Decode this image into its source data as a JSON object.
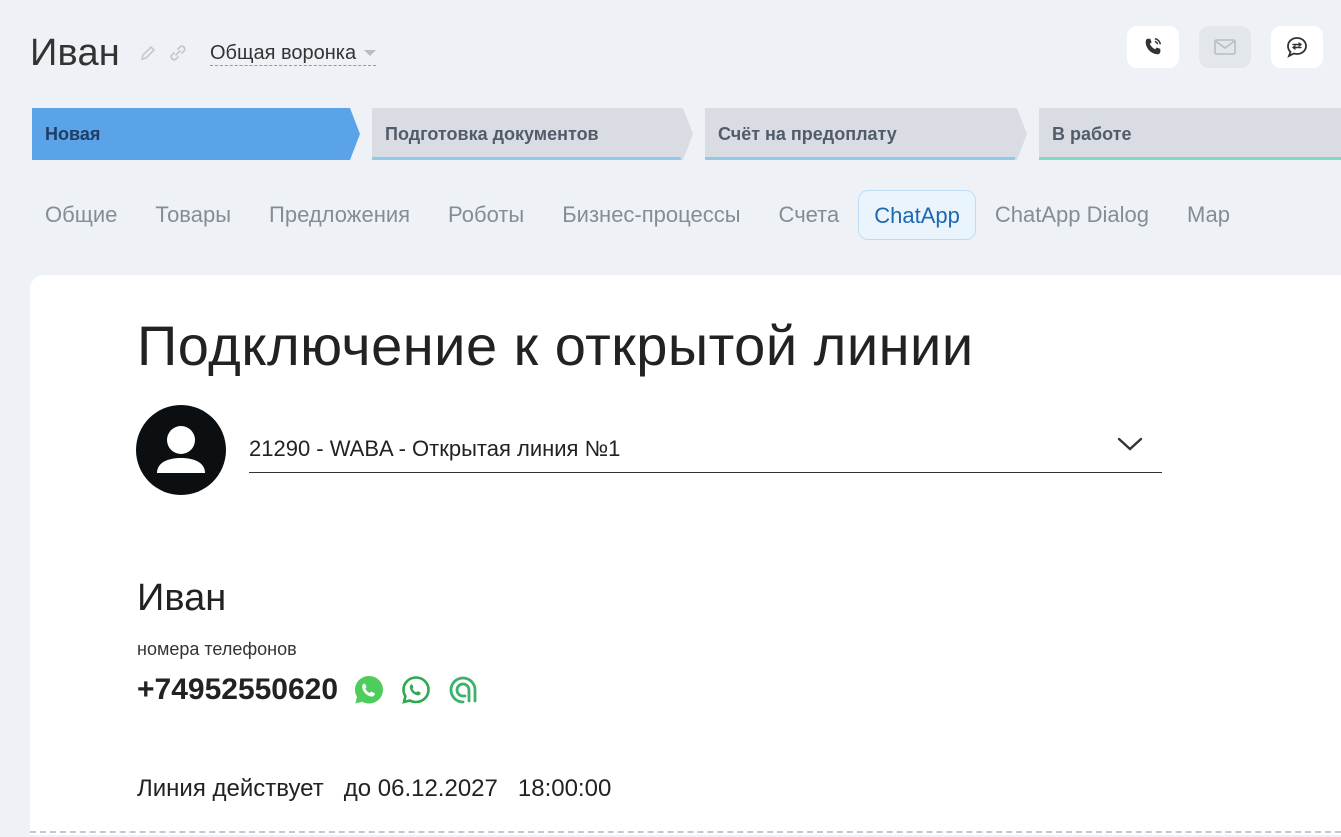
{
  "header": {
    "title": "Иван",
    "edit_icon": "pencil-icon",
    "link_icon": "link-icon",
    "funnel_label": "Общая воронка"
  },
  "actions": {
    "call_icon": "phone-icon",
    "mail_icon": "envelope-icon",
    "chat_icon": "chat-icon"
  },
  "stages": [
    {
      "label": "Новая"
    },
    {
      "label": "Подготовка документов"
    },
    {
      "label": "Счёт на предоплату"
    },
    {
      "label": "В работе"
    }
  ],
  "tabs": [
    {
      "label": "Общие"
    },
    {
      "label": "Товары"
    },
    {
      "label": "Предложения"
    },
    {
      "label": "Роботы"
    },
    {
      "label": "Бизнес-процессы"
    },
    {
      "label": "Счета"
    },
    {
      "label": "ChatApp"
    },
    {
      "label": "ChatApp Dialog"
    },
    {
      "label": "Мар"
    }
  ],
  "active_tab": "ChatApp",
  "card": {
    "title": "Подключение к открытой линии",
    "line_select_value": "21290 - WABA - Открытая линия №1",
    "contact_name": "Иван",
    "phones_label": "номера телефонов",
    "phone": "+74952550620",
    "messenger_icons": [
      "whatsapp-filled-icon",
      "whatsapp-outline-icon",
      "chatapp-icon"
    ],
    "validity_text": "Линия действует   до 06.12.2027   18:00:00"
  },
  "colors": {
    "active_stage": "#5aa3e8",
    "stage": "#d9dde3",
    "active_tab_text": "#2067b0",
    "whatsapp": "#4fcd5c",
    "whatsapp_outline": "#2fa84f",
    "chatapp": "#3ab26b"
  }
}
